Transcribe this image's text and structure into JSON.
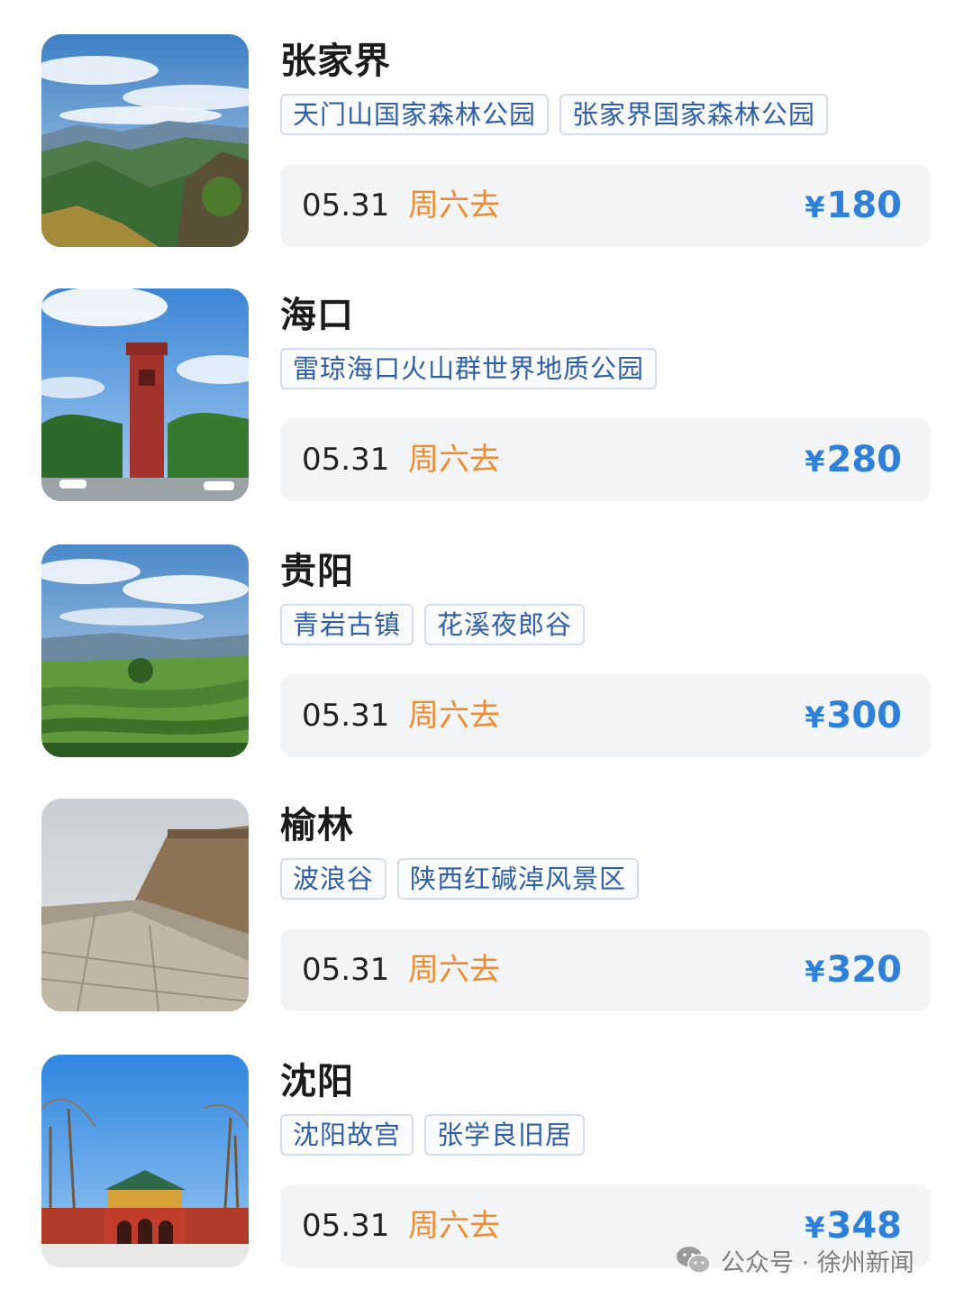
{
  "trips": [
    {
      "city": "张家界",
      "tags": [
        "天门山国家森林公园",
        "张家界国家森林公园"
      ],
      "date": "05.31",
      "weekday": "周六去",
      "currency": "¥",
      "price": "180"
    },
    {
      "city": "海口",
      "tags": [
        "雷琼海口火山群世界地质公园"
      ],
      "date": "05.31",
      "weekday": "周六去",
      "currency": "¥",
      "price": "280"
    },
    {
      "city": "贵阳",
      "tags": [
        "青岩古镇",
        "花溪夜郎谷"
      ],
      "date": "05.31",
      "weekday": "周六去",
      "currency": "¥",
      "price": "300"
    },
    {
      "city": "榆林",
      "tags": [
        "波浪谷",
        "陕西红碱淖风景区"
      ],
      "date": "05.31",
      "weekday": "周六去",
      "currency": "¥",
      "price": "320"
    },
    {
      "city": "沈阳",
      "tags": [
        "沈阳故宫",
        "张学良旧居"
      ],
      "date": "05.31",
      "weekday": "周六去",
      "currency": "¥",
      "price": "348"
    }
  ],
  "watermark": {
    "text": "公众号 · 徐州新闻",
    "icon": "wechat-icon"
  },
  "colors": {
    "price": "#2f80d8",
    "weekday": "#f08c2e",
    "tag_text": "#2f5fa8",
    "bar_bg": "#f3f4f6"
  }
}
